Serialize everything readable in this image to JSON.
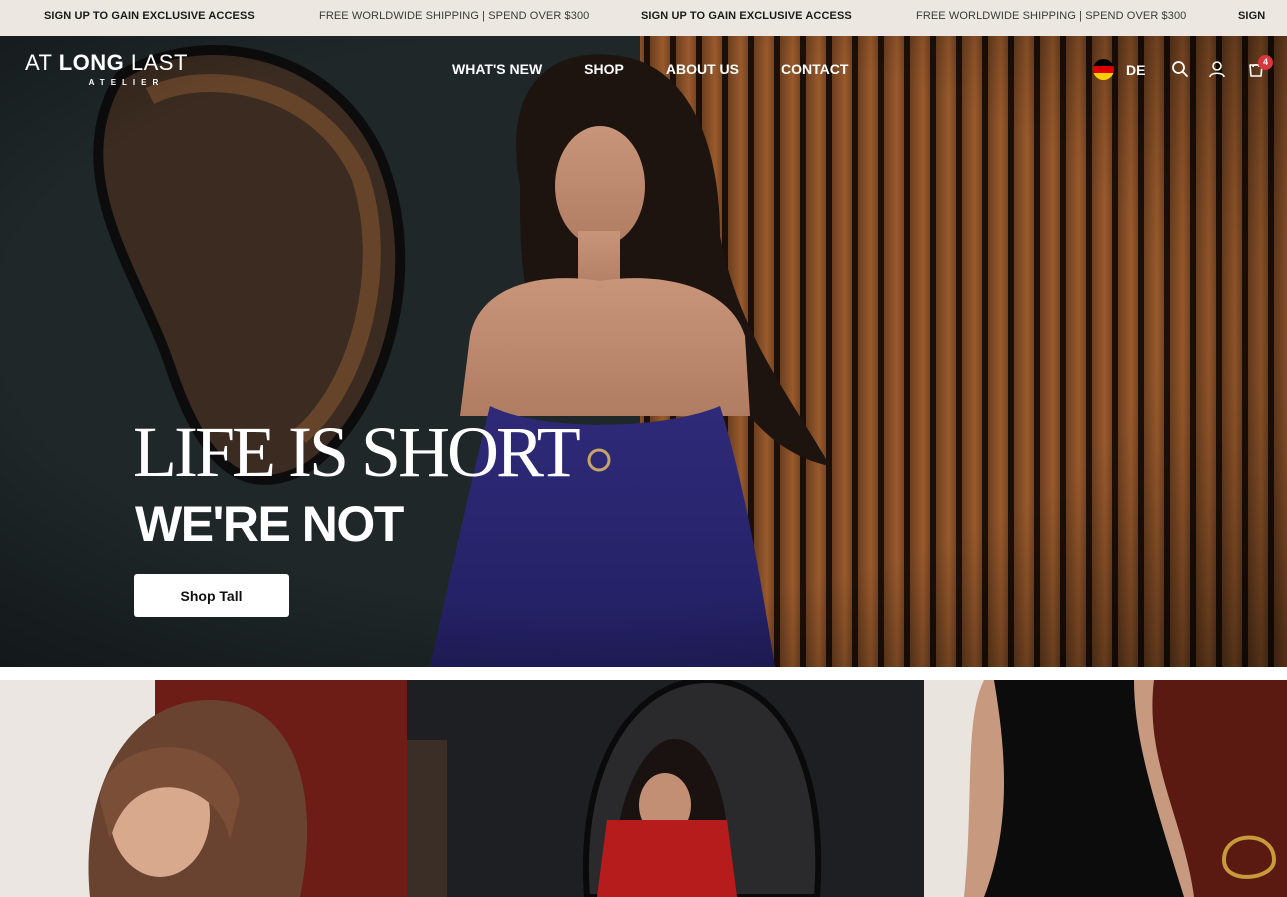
{
  "announcement": {
    "items": [
      "SIGN UP TO GAIN EXCLUSIVE ACCESS",
      "FREE WORLDWIDE SHIPPING | SPEND OVER $300",
      "SIGN UP TO GAIN EXCLUSIVE ACCESS",
      "FREE WORLDWIDE SHIPPING | SPEND OVER $300",
      "SIGN"
    ]
  },
  "header": {
    "logo": {
      "main_light": "AT ",
      "main_bold": "LONG",
      "main_light2": " LAST",
      "sub": "ATELIER"
    },
    "nav": [
      "WHAT'S NEW",
      "SHOP",
      "ABOUT US",
      "CONTACT"
    ],
    "locale": {
      "code": "DE",
      "flag_colors": [
        "#000000",
        "#dd0000",
        "#ffce00"
      ]
    },
    "icons": [
      "search-icon",
      "account-icon",
      "cart-icon"
    ],
    "cart_count": "4"
  },
  "hero": {
    "headline_line1": "LIFE IS SHORT",
    "headline_line2": "WE'RE NOT",
    "cta_label": "Shop Tall"
  },
  "colors": {
    "announcement_bg": "#ece8e1",
    "badge": "#d9363e",
    "dress": "#2e2a78"
  }
}
